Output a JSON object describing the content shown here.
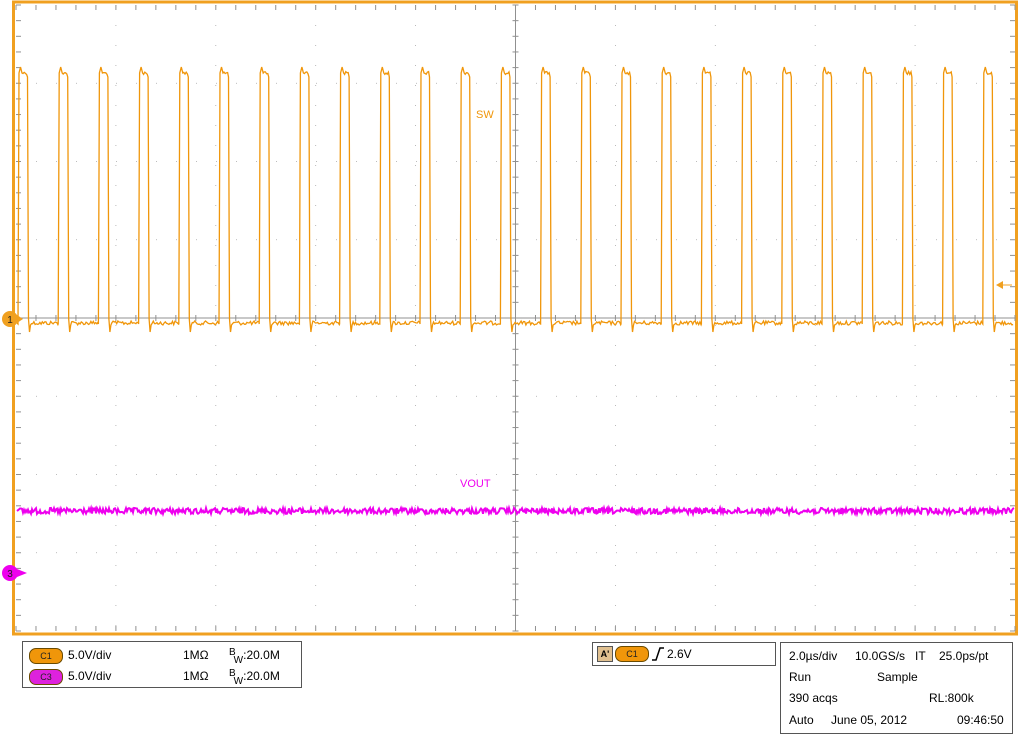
{
  "colors": {
    "frame": "#f0a020",
    "ch1": "#f0960a",
    "ch3": "#ee00ee",
    "grid": "#a8a8a8",
    "graticule": "#909090"
  },
  "screen": {
    "markers": {
      "ch1": "1",
      "ch3": "3"
    },
    "trace_labels": {
      "ch1": "SW",
      "ch3": "VOUT"
    },
    "icons": {
      "trigger_level": "left-arrow-icon",
      "ch_marker": "pointer-badge-icon"
    }
  },
  "channels": [
    {
      "badge": "C1",
      "scale": "5.0V/div",
      "impedance": "1MΩ",
      "bw_prefix": "B",
      "bw_sub": "W",
      "bw_value": ":20.0M"
    },
    {
      "badge": "C3",
      "scale": "5.0V/div",
      "impedance": "1MΩ",
      "bw_prefix": "B",
      "bw_sub": "W",
      "bw_value": ":20.0M"
    }
  ],
  "trigger": {
    "tag": "A'",
    "source": "C1",
    "level": "2.6V",
    "slope_icon": "rising-edge-icon"
  },
  "acquisition": {
    "timebase": "2.0µs/div",
    "sample_rate": "10.0GS/s",
    "it": "IT",
    "resolution": "25.0ps/pt",
    "run_state": "Run",
    "mode": "Sample",
    "acqs": "390 acqs",
    "record_length": "RL:800k",
    "trigger_mode": "Auto",
    "date": "June 05, 2012",
    "time": "09:46:50"
  }
}
